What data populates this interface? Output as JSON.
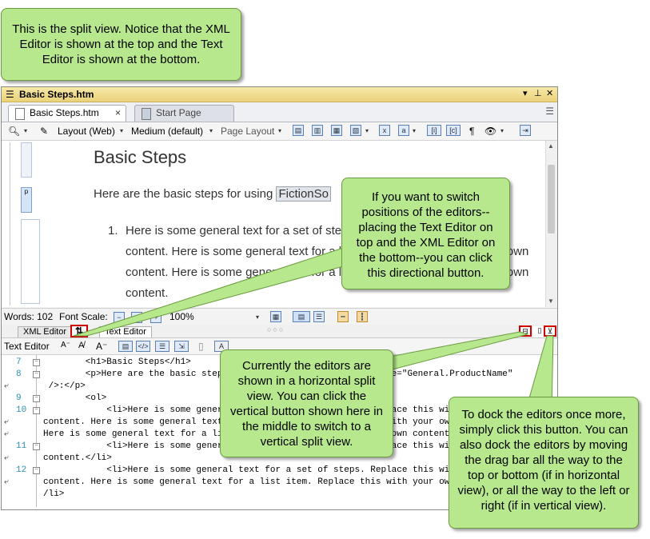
{
  "window": {
    "title": "Basic Steps.htm",
    "menu_icon": "hamburger-menu-icon",
    "pin_icon": "pin-icon",
    "close_icon": "close-icon"
  },
  "tabs": [
    {
      "label": "Basic Steps.htm",
      "active": true,
      "close": "×"
    },
    {
      "label": "Start Page",
      "active": false
    }
  ],
  "toolbar": {
    "layout": "Layout (Web)",
    "medium": "Medium (default)",
    "page_layout": "Page Layout",
    "pilcrow": "¶"
  },
  "document": {
    "heading": "Basic Steps",
    "para_prefix": "Here are the basic steps for using ",
    "variable": "FictionSo",
    "list_number": "1.",
    "list_text": "Here is some general text for a set of steps. Replace this with your own content. Here is some general text for a list item. Replace this with your own content. Here is some general text for a list item. Replace this with your own content."
  },
  "status": {
    "words": "Words: 102",
    "font_scale": "Font Scale:",
    "zoom": "100%"
  },
  "editor_tabs": {
    "xml_editor": "XML Editor",
    "text_editor": "Text Editor",
    "switch_symbol": "⇅",
    "grip": "○○○"
  },
  "text_toolbar": {
    "label": "Text Editor"
  },
  "code_lines": [
    {
      "num": "7",
      "text": "        <h1>Basic Steps</h1>",
      "wrap": false
    },
    {
      "num": "8",
      "text": "        <p>Here are the basic steps for using <MadCap:variable name=\"General.ProductName\"",
      "wrap": false
    },
    {
      "num": "",
      "text": " />:</p>",
      "wrap": true
    },
    {
      "num": "9",
      "text": "        <ol>",
      "wrap": false
    },
    {
      "num": "10",
      "text": "            <li>Here is some general text for a set of steps. Replace this with your own",
      "wrap": false
    },
    {
      "num": "",
      "text": "content. Here is some general text for a list item. Replace this with your own content.",
      "wrap": true
    },
    {
      "num": "",
      "text": "Here is some general text for a list item. Replace this with your own content.</li>",
      "wrap": true
    },
    {
      "num": "11",
      "text": "            <li>Here is some general text for a set of steps. Replace this with your own",
      "wrap": false
    },
    {
      "num": "",
      "text": "content.</li>",
      "wrap": true
    },
    {
      "num": "12",
      "text": "            <li>Here is some general text for a set of steps. Replace this with your own",
      "wrap": false
    },
    {
      "num": "",
      "text": "content. Here is some general text for a list item. Replace this with your own content.<",
      "wrap": true
    },
    {
      "num": "",
      "text": "/li>",
      "wrap": false
    }
  ],
  "callouts": {
    "split_view": "This is the split view. Notice that the XML Editor is shown at the top and the Text Editor is shown at the bottom.",
    "switch_positions": "If you want to switch positions of the editors--placing the Text Editor on top and the XML Editor on the bottom--you can click this directional button.",
    "vertical": "Currently the editors are shown in a horizontal split view. You can click the vertical button shown here in the middle to switch to a vertical split view.",
    "dock": "To dock the editors once more, simply click this button. You can also dock the editors by moving the drag bar all the way to the top or bottom (if in horizontal view), or all the way to the left or right (if in vertical view)."
  },
  "colors": {
    "callout_fill": "#b7e88e",
    "callout_border": "#6a9a3f",
    "highlight_red": "#cc0000",
    "titlebar": "#f0dd8f"
  }
}
